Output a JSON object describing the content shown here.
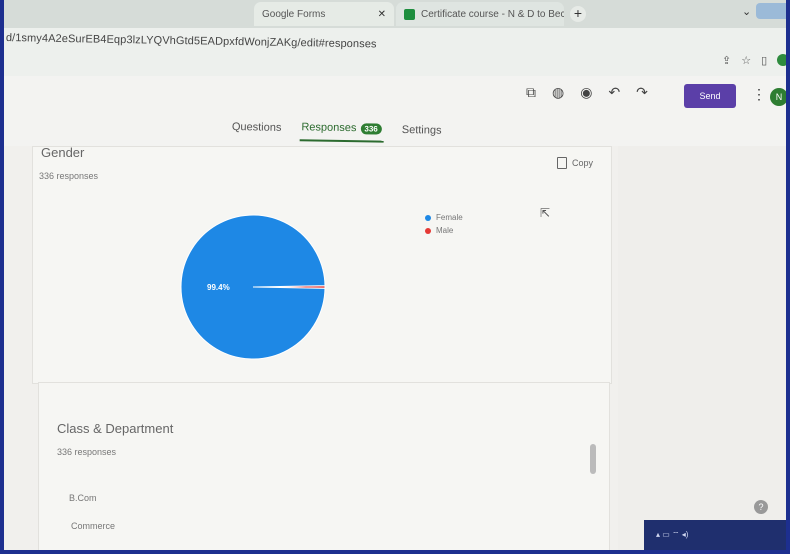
{
  "browser": {
    "tabs": [
      {
        "label": "Google Forms"
      },
      {
        "label": "Certificate course - N & D to Bec"
      }
    ],
    "new_tab_label": "+",
    "url": "d/1smy4A2eSurEB4Eqp3lzLYQVhGtd5EADpxfdWonjZAKg/edit#responses"
  },
  "form_header": {
    "tool_icons": [
      "palette-icon",
      "preview-icon",
      "undo-icon",
      "redo-icon"
    ],
    "send_label": "Send",
    "avatar_initial": "N",
    "tabs": [
      {
        "label": "Questions",
        "active": false
      },
      {
        "label": "Responses",
        "active": true,
        "count": "336"
      },
      {
        "label": "Settings",
        "active": false
      }
    ]
  },
  "gender_card": {
    "title": "Gender",
    "subtitle": "336 responses",
    "copy_label": "Copy",
    "chart_data": {
      "type": "pie",
      "title": "",
      "categories": [
        "Female",
        "Male"
      ],
      "values": [
        99.4,
        0.6
      ],
      "labels": [
        "99.4%",
        ""
      ],
      "colors": [
        "#1e88e5",
        "#e53935"
      ],
      "legend_position": "right"
    }
  },
  "class_card": {
    "title": "Class & Department",
    "subtitle": "336 responses",
    "options": [
      "B.Com",
      "Commerce"
    ]
  },
  "colors": {
    "accent": "#5b3fa8",
    "responses_green": "#2e7d32"
  }
}
